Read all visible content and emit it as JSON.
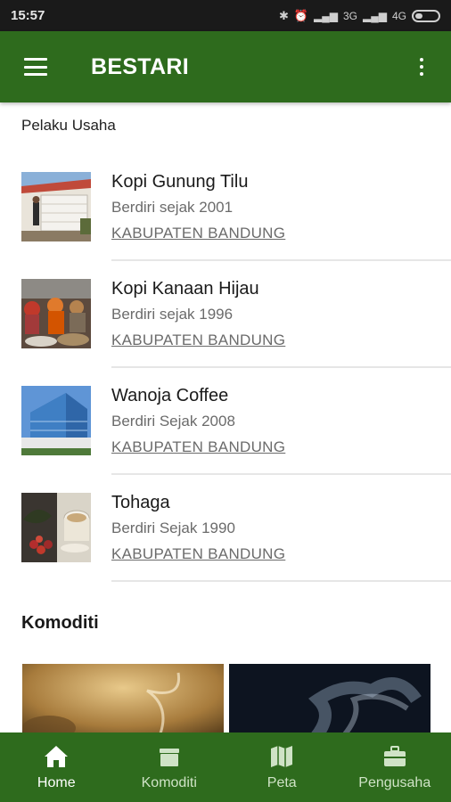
{
  "status_bar": {
    "time": "15:57",
    "network_1": "3G",
    "network_2": "4G"
  },
  "app_bar": {
    "title": "BESTARI"
  },
  "pelaku_usaha": {
    "section_label": "Pelaku Usaha",
    "items": [
      {
        "name": "Kopi Gunung Tilu",
        "since": "Berdiri sejak 2001",
        "region": "KABUPATEN BANDUNG",
        "thumb": "person-at-building"
      },
      {
        "name": "Kopi Kanaan Hijau",
        "since": "Berdiri sejak 1996",
        "region": "KABUPATEN BANDUNG",
        "thumb": "workers-sorting"
      },
      {
        "name": "Wanoja Coffee",
        "since": "Berdiri Sejak 2008",
        "region": "KABUPATEN BANDUNG",
        "thumb": "glass-building"
      },
      {
        "name": "Tohaga",
        "since": "Berdiri Sejak 1990",
        "region": "KABUPATEN BANDUNG",
        "thumb": "coffee-cherries-cup"
      }
    ]
  },
  "komoditi": {
    "section_label": "Komoditi",
    "cards": [
      "steaming-coffee",
      "smoke-dark"
    ]
  },
  "bottom_nav": {
    "items": [
      {
        "label": "Home",
        "icon": "home-icon",
        "active": true
      },
      {
        "label": "Komoditi",
        "icon": "box-icon",
        "active": false
      },
      {
        "label": "Peta",
        "icon": "map-icon",
        "active": false
      },
      {
        "label": "Pengusaha",
        "icon": "briefcase-icon",
        "active": false
      }
    ]
  },
  "colors": {
    "primary": "#2e6b1d",
    "status_bar": "#1a1a1a"
  }
}
